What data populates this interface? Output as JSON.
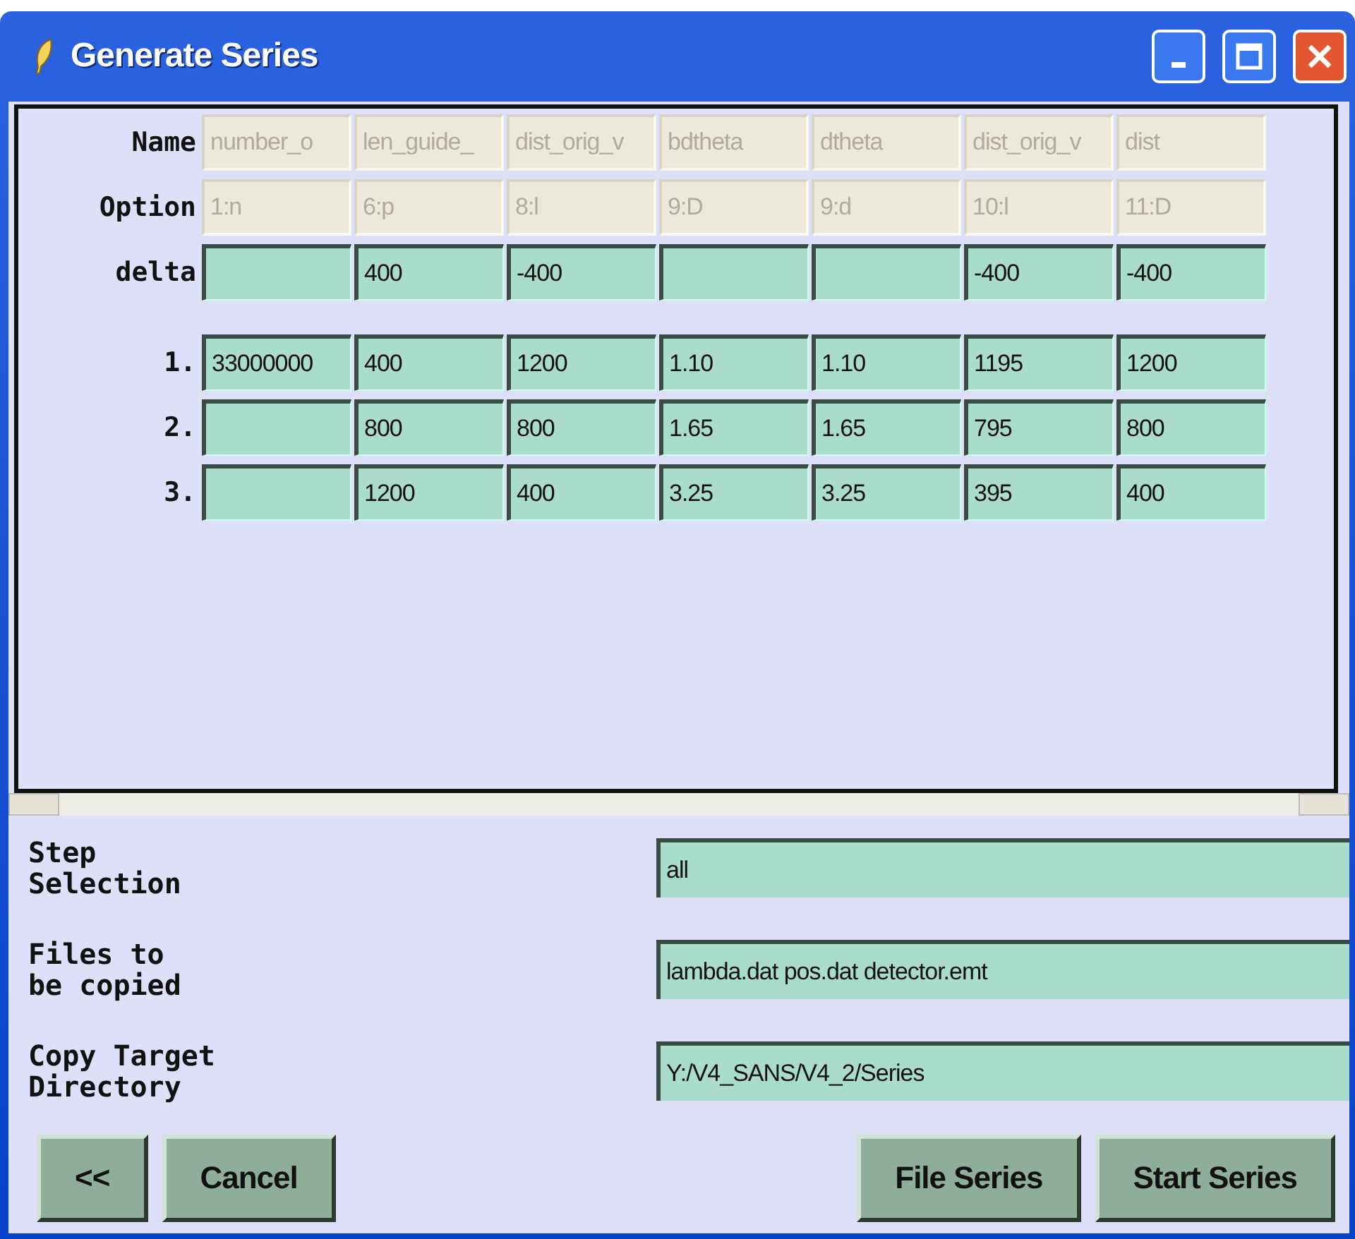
{
  "window": {
    "title": "Generate Series"
  },
  "header_rows": [
    {
      "label": "Name",
      "disabled": true,
      "cells": [
        "number_o",
        "len_guide_",
        "dist_orig_v",
        "bdtheta",
        "dtheta",
        "dist_orig_v",
        "dist"
      ]
    },
    {
      "label": "Option",
      "disabled": true,
      "cells": [
        "1:n",
        "6:p",
        "8:l",
        "9:D",
        "9:d",
        "10:l",
        "11:D"
      ]
    },
    {
      "label": "delta",
      "disabled": false,
      "cells": [
        null,
        "400",
        "-400",
        null,
        null,
        "-400",
        "-400"
      ]
    }
  ],
  "rows": [
    {
      "label": "1.",
      "cells": [
        "33000000",
        "400",
        "1200",
        "1.10",
        "1.10",
        "1195",
        "1200"
      ]
    },
    {
      "label": "2.",
      "cells": [
        null,
        "800",
        "800",
        "1.65",
        "1.65",
        "795",
        "800"
      ]
    },
    {
      "label": "3.",
      "cells": [
        null,
        "1200",
        "400",
        "3.25",
        "3.25",
        "395",
        "400"
      ]
    }
  ],
  "fields": [
    {
      "label": "Step\nSelection",
      "value": "all"
    },
    {
      "label": "Files to\nbe copied",
      "value": "lambda.dat pos.dat detector.emt"
    },
    {
      "label": "Copy Target\nDirectory",
      "value": "Y:/V4_SANS/V4_2/Series"
    }
  ],
  "buttons_left": [
    "<<",
    "Cancel"
  ],
  "buttons_right": [
    "File Series",
    "Start Series"
  ]
}
